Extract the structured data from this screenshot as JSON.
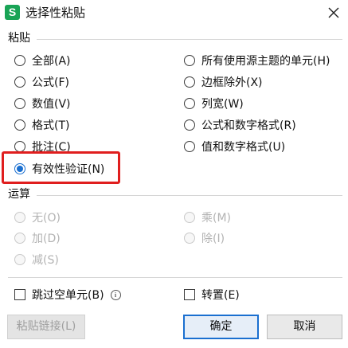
{
  "window": {
    "app_icon_letter": "S",
    "title": "选择性粘贴",
    "close_icon": "close-icon"
  },
  "paste_section": {
    "label": "粘贴",
    "left_options": [
      {
        "label": "全部(A)",
        "checked": false
      },
      {
        "label": "公式(F)",
        "checked": false
      },
      {
        "label": "数值(V)",
        "checked": false
      },
      {
        "label": "格式(T)",
        "checked": false
      },
      {
        "label": "批注(C)",
        "checked": false
      },
      {
        "label": "有效性验证(N)",
        "checked": true
      }
    ],
    "right_options": [
      {
        "label": "所有使用源主题的单元(H)",
        "checked": false
      },
      {
        "label": "边框除外(X)",
        "checked": false
      },
      {
        "label": "列宽(W)",
        "checked": false
      },
      {
        "label": "公式和数字格式(R)",
        "checked": false
      },
      {
        "label": "值和数字格式(U)",
        "checked": false
      }
    ]
  },
  "operation_section": {
    "label": "运算",
    "left_options": [
      {
        "label": "无(O)",
        "checked": true,
        "disabled": true
      },
      {
        "label": "加(D)",
        "checked": false,
        "disabled": true
      },
      {
        "label": "减(S)",
        "checked": false,
        "disabled": true
      }
    ],
    "right_options": [
      {
        "label": "乘(M)",
        "checked": false,
        "disabled": true
      },
      {
        "label": "除(I)",
        "checked": false,
        "disabled": true
      }
    ]
  },
  "checkboxes": {
    "skip_blanks": {
      "label": "跳过空单元(B)",
      "checked": false,
      "info_icon": "i"
    },
    "transpose": {
      "label": "转置(E)",
      "checked": false
    }
  },
  "buttons": {
    "paste_link": "粘贴链接(L)",
    "ok": "确定",
    "cancel": "取消"
  },
  "colors": {
    "accent": "#1a6fd0",
    "highlight": "#e01e1e",
    "app_icon": "#19a456"
  }
}
